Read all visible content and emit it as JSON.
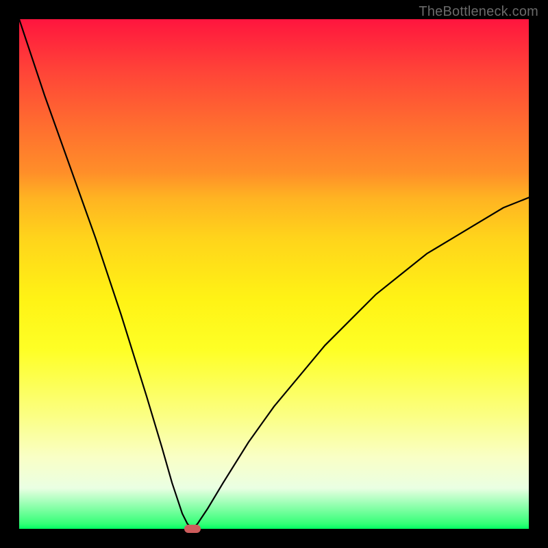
{
  "watermark": "TheBottleneck.com",
  "chart_data": {
    "type": "line",
    "title": "",
    "xlabel": "",
    "ylabel": "",
    "xlim": [
      0,
      100
    ],
    "ylim": [
      0,
      100
    ],
    "grid": false,
    "legend": false,
    "series": [
      {
        "name": "curve",
        "color": "#000000",
        "x": [
          0,
          5,
          10,
          15,
          20,
          25,
          28,
          30,
          32,
          33,
          34,
          35,
          37,
          40,
          45,
          50,
          55,
          60,
          65,
          70,
          75,
          80,
          85,
          90,
          95,
          100
        ],
        "values": [
          100,
          85,
          71,
          57,
          42,
          26,
          16,
          9,
          3,
          1,
          0,
          1,
          4,
          9,
          17,
          24,
          30,
          36,
          41,
          46,
          50,
          54,
          57,
          60,
          63,
          65
        ]
      }
    ],
    "annotations": [
      {
        "name": "min-marker",
        "x": 34,
        "y": 0,
        "shape": "rounded-rect",
        "color": "#cd5c5c"
      }
    ],
    "background_gradient": {
      "direction": "vertical",
      "stops": [
        {
          "pos": 0,
          "color": "#ff153e"
        },
        {
          "pos": 35,
          "color": "#ffb322"
        },
        {
          "pos": 55,
          "color": "#fff315"
        },
        {
          "pos": 86,
          "color": "#f9ffc6"
        },
        {
          "pos": 100,
          "color": "#00ff62"
        }
      ]
    }
  }
}
